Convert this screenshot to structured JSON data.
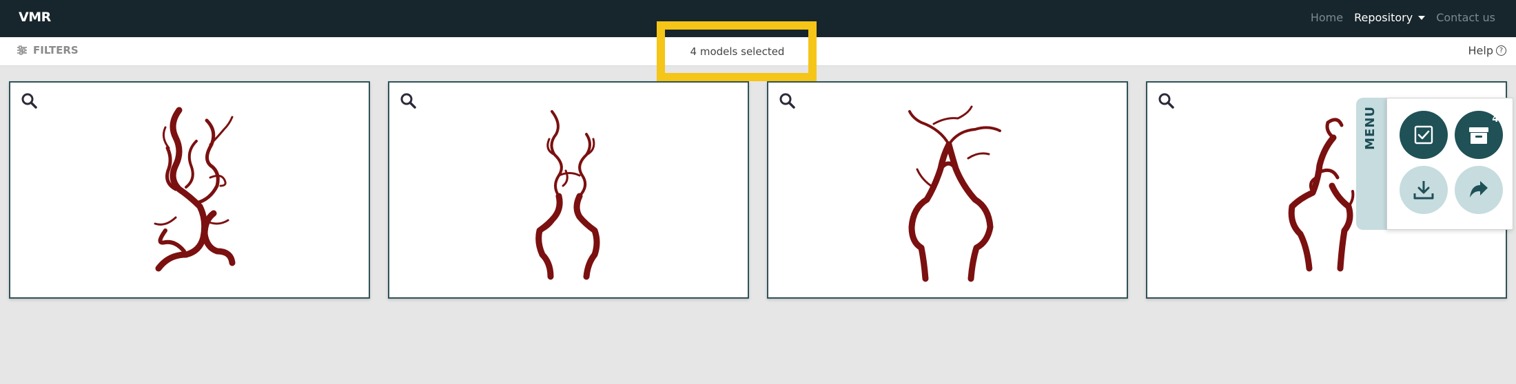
{
  "nav": {
    "brand": "VMR",
    "home": "Home",
    "repository": "Repository",
    "contact": "Contact us"
  },
  "filterbar": {
    "filters_label": "FILTERS",
    "selected_text": "4 models selected",
    "help_label": "Help",
    "help_icon": "?"
  },
  "menu": {
    "tab_label": "MENU",
    "cart_count": "4"
  },
  "colors": {
    "topbar": "#17262c",
    "accent": "#1f5157",
    "accent_light": "#c6dcdf",
    "highlight": "#f5c518",
    "vessel": "#7b1010"
  }
}
